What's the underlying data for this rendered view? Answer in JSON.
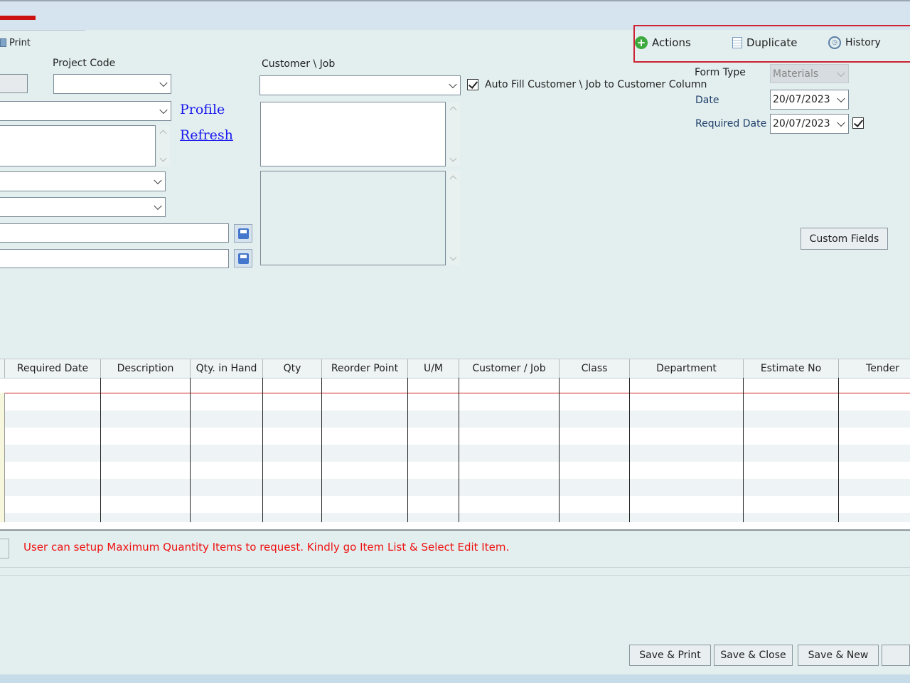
{
  "toolbar": {
    "print_label": "Print",
    "actions_label": "Actions",
    "duplicate_label": "Duplicate",
    "history_label": "History"
  },
  "form": {
    "project_code_label": "Project Code",
    "customer_job_label": "Customer \\ Job",
    "auto_fill_label": "Auto Fill Customer \\ Job to Customer Column",
    "form_type_label": "Form Type",
    "form_type_value": "Materials",
    "date_label": "Date",
    "date_value": "20/07/2023",
    "required_date_label": "Required Date",
    "required_date_value": "20/07/2023",
    "profile_link": "Profile",
    "refresh_link": "Refresh",
    "custom_fields_label": "Custom Fields"
  },
  "grid": {
    "columns": [
      "Required Date",
      "Description",
      "Qty. in Hand",
      "Qty",
      "Reorder Point",
      "U/M",
      "Customer / Job",
      "Class",
      "Department",
      "Estimate No",
      "Tender"
    ]
  },
  "message": "User can setup Maximum Quantity  Items to request. Kindly go Item List & Select Edit Item.",
  "footer": {
    "save_print": "Save & Print",
    "save_close": "Save & Close",
    "save_new": "Save & New"
  },
  "colors": {
    "background": "#e3eeee",
    "highlight_border": "#cc2233",
    "link": "#1a1aee",
    "message": "#ee1111"
  }
}
